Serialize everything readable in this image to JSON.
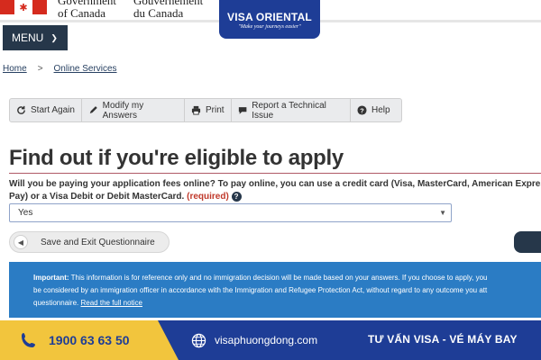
{
  "gov": {
    "en_line1": "Government",
    "en_line2": "of Canada",
    "fr_line1": "Gouvernement",
    "fr_line2": "du Canada"
  },
  "brand": {
    "name": "VISA ORIENTAL",
    "tagline": "\"Make your journeys easier\""
  },
  "menu": {
    "label": "MENU"
  },
  "breadcrumb": {
    "home": "Home",
    "separator": ">",
    "current": "Online Services"
  },
  "toolbar": {
    "start_again": "Start Again",
    "modify_answers": "Modify my Answers",
    "print": "Print",
    "report_issue": "Report a Technical Issue",
    "help": "Help"
  },
  "page": {
    "title": "Find out if you're eligible to apply"
  },
  "question": {
    "line1": "Will you be paying your application fees online?  To pay online, you can use a credit card (Visa, MasterCard, American Express",
    "line2": "Pay) or a Visa Debit or Debit MasterCard.",
    "required": "(required)",
    "help_glyph": "?"
  },
  "select": {
    "value": "Yes"
  },
  "actions": {
    "save_exit": "Save and Exit Questionnaire"
  },
  "important": {
    "label": "Important:",
    "line1": "This information is for reference only and no immigration decision will be made based on your answers. If you choose to apply, you",
    "line2": "be considered by an immigration officer in accordance with the Immigration and Refugee Protection Act, without regard to any outcome you att",
    "line3": "questionnaire.",
    "link": "Read the full notice"
  },
  "footer": {
    "phone": "1900 63 63 50",
    "website": "visaphuongdong.com",
    "service": "TƯ VẤN VISA - VÉ MÁY BAY"
  },
  "colors": {
    "gov_navy": "#26374a",
    "brand_blue": "#1e3d96",
    "accent_yellow": "#f2c53d",
    "notice_blue": "#2b7cc4",
    "required_red": "#c0392b"
  },
  "icons": [
    "maple-leaf-icon",
    "chevron-down-icon",
    "refresh-icon",
    "pencil-icon",
    "printer-icon",
    "comment-icon",
    "question-icon",
    "phone-icon",
    "globe-icon"
  ]
}
